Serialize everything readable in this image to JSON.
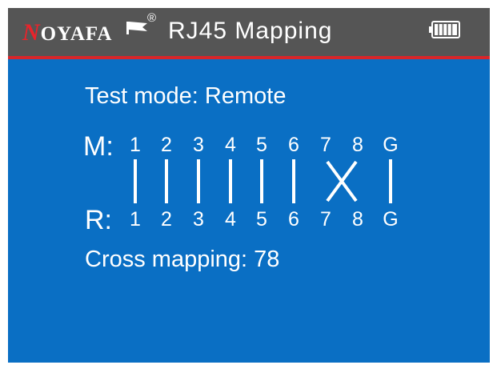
{
  "header": {
    "brand_initial": "N",
    "brand_rest": "OYAFA",
    "registered": "®",
    "title": "RJ45  Mapping",
    "battery_level": 1.0,
    "colors": {
      "bar": "#555555",
      "accent": "#d8262a",
      "screen": "#0a6fc4"
    }
  },
  "main": {
    "test_mode": "Test mode: Remote",
    "main_label": "M:",
    "remote_label": "R:",
    "main_pins": [
      "1",
      "2",
      "3",
      "4",
      "5",
      "6",
      "7",
      "8",
      "G"
    ],
    "remote_pins": [
      "1",
      "2",
      "3",
      "4",
      "5",
      "6",
      "7",
      "8",
      "G"
    ],
    "connections": [
      "straight",
      "straight",
      "straight",
      "straight",
      "straight",
      "straight",
      "cross",
      "cross",
      "straight"
    ],
    "result": "Cross mapping: 78"
  }
}
